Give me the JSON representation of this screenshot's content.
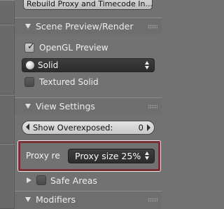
{
  "top_button": {
    "label": "Rebuild Proxy and Timecode In..."
  },
  "scene_preview": {
    "title": "Scene Preview/Render",
    "opengl_preview": {
      "label": "OpenGL Preview",
      "checked": true
    },
    "shading": {
      "value": "Solid",
      "icon": "solid-sphere-icon"
    },
    "textured_solid": {
      "label": "Textured Solid",
      "checked": false
    }
  },
  "view_settings": {
    "title": "View Settings",
    "show_overexposed": {
      "label": "Show Overexposed:",
      "value": "0"
    },
    "proxy_render_size": {
      "label": "Proxy re",
      "value": "Proxy size 25%"
    },
    "safe_areas": {
      "label": "Safe Areas",
      "checked": false
    }
  },
  "modifiers": {
    "title": "Modifiers"
  },
  "colors": {
    "highlight_border": "#7a2e36",
    "panel_bg": "#727272"
  }
}
